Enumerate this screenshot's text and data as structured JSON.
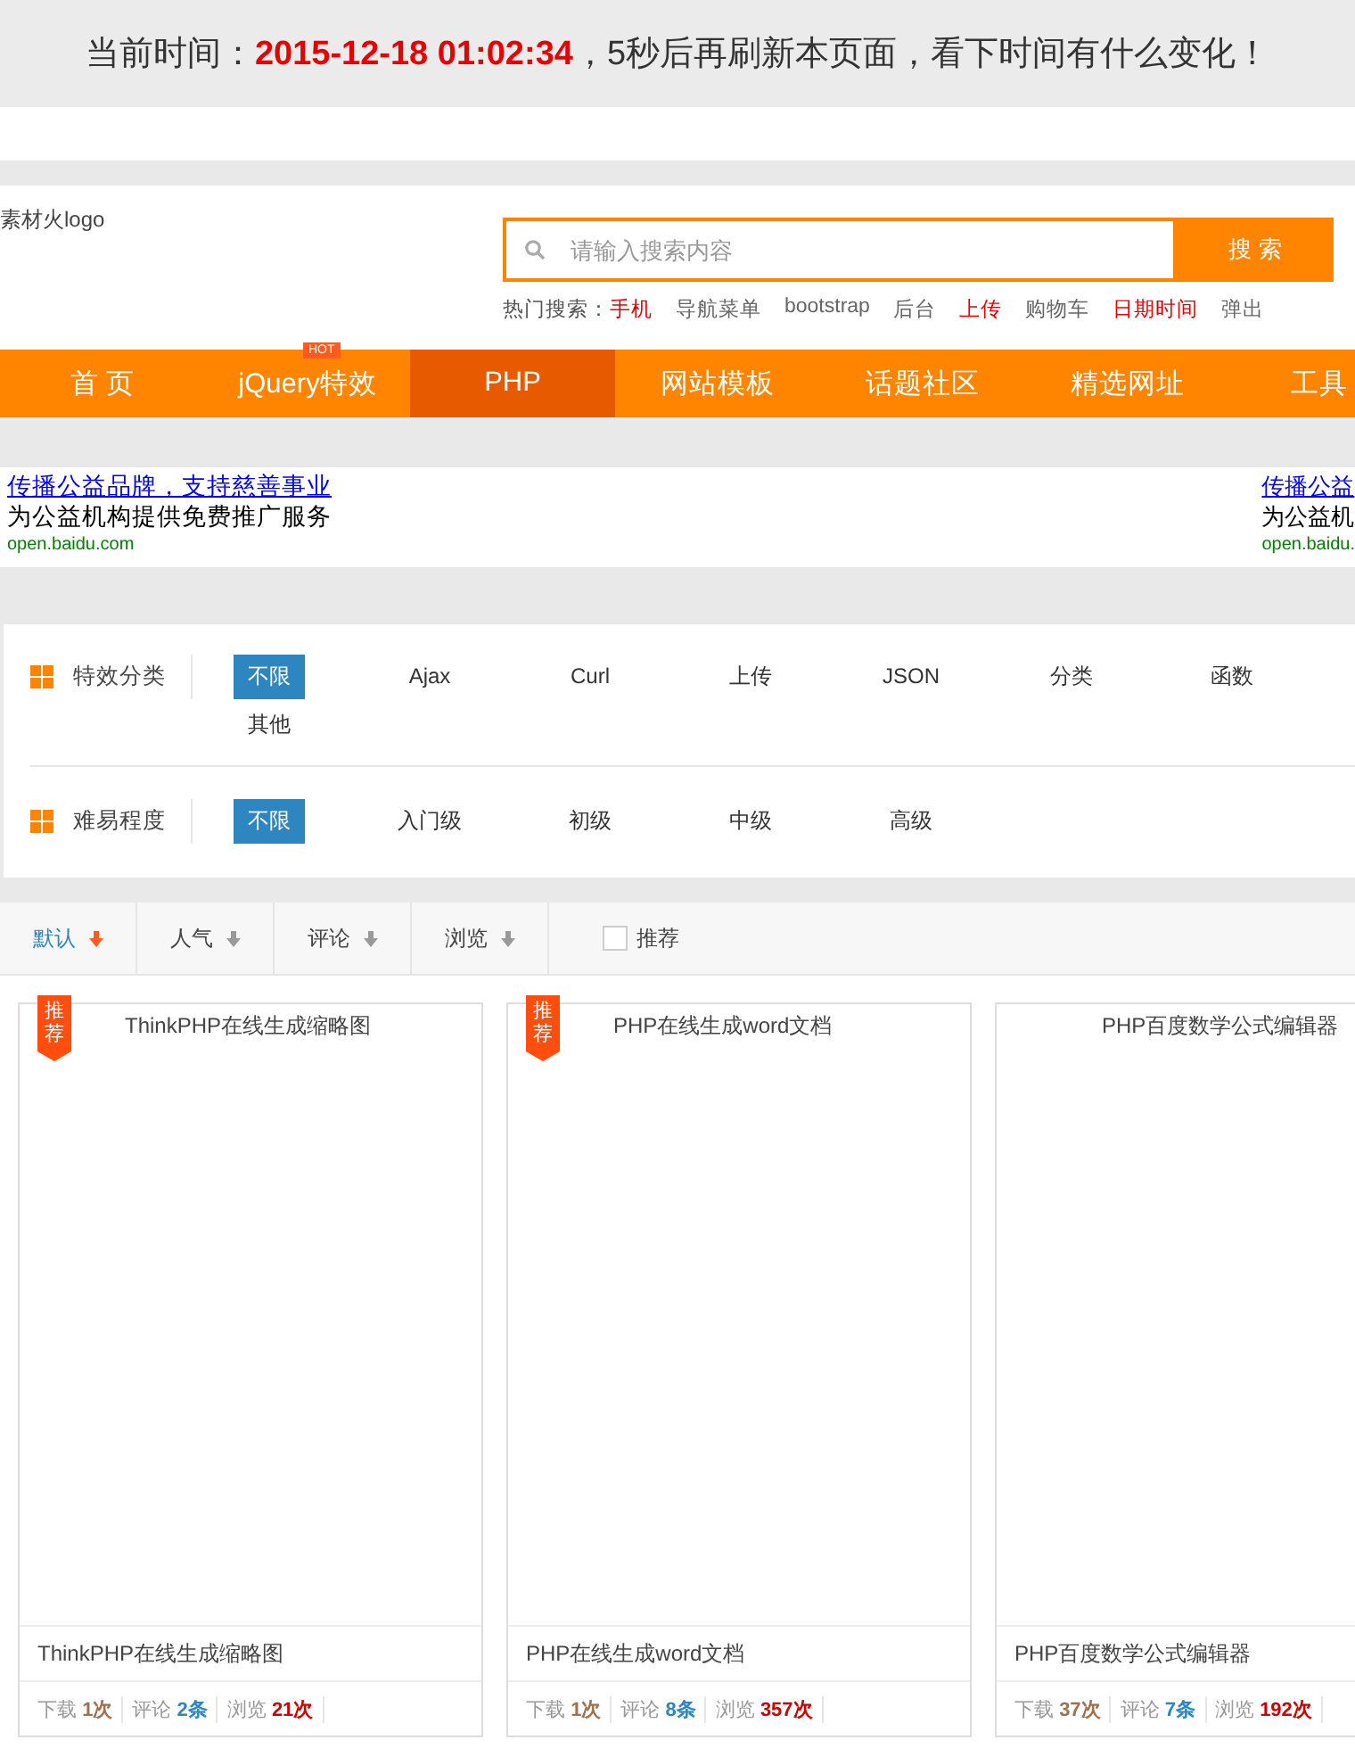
{
  "notice": {
    "prefix": "当前时间：",
    "time": "2015-12-18 01:02:34",
    "suffix": "，5秒后再刷新本页面，看下时间有什么变化！"
  },
  "header": {
    "logo": "素材火logo",
    "search": {
      "placeholder": "请输入搜索内容",
      "button": "搜 索"
    },
    "hot_label": "热门搜索：",
    "hot_items": [
      {
        "label": "手机",
        "hot": true
      },
      {
        "label": "导航菜单",
        "hot": false
      },
      {
        "label": "bootstrap",
        "hot": false
      },
      {
        "label": "后台",
        "hot": false
      },
      {
        "label": "上传",
        "hot": true
      },
      {
        "label": "购物车",
        "hot": false
      },
      {
        "label": "日期时间",
        "hot": true
      },
      {
        "label": "弹出",
        "hot": false
      }
    ]
  },
  "nav": [
    {
      "label": "首 页",
      "selected": false
    },
    {
      "label": "jQuery特效",
      "selected": false,
      "badge": "HOT"
    },
    {
      "label": "PHP",
      "selected": true
    },
    {
      "label": "网站模板",
      "selected": false
    },
    {
      "label": "话题社区",
      "selected": false
    },
    {
      "label": "精选网址",
      "selected": false
    },
    {
      "label": "工具",
      "selected": false
    }
  ],
  "ads": [
    {
      "link": "传播公益品牌，支持慈善事业",
      "text": "为公益机构提供免费推广服务",
      "url": "open.baidu.com"
    },
    {
      "link": "传播公益",
      "text": "为公益机",
      "url": "open.baidu."
    }
  ],
  "filters": [
    {
      "label": "特效分类",
      "options": [
        {
          "label": "不限",
          "selected": true
        },
        {
          "label": "Ajax",
          "selected": false
        },
        {
          "label": "Curl",
          "selected": false
        },
        {
          "label": "上传",
          "selected": false
        },
        {
          "label": "JSON",
          "selected": false
        },
        {
          "label": "分类",
          "selected": false
        },
        {
          "label": "函数",
          "selected": false
        },
        {
          "label": "其他",
          "selected": false
        }
      ]
    },
    {
      "label": "难易程度",
      "options": [
        {
          "label": "不限",
          "selected": true
        },
        {
          "label": "入门级",
          "selected": false
        },
        {
          "label": "初级",
          "selected": false
        },
        {
          "label": "中级",
          "selected": false
        },
        {
          "label": "高级",
          "selected": false
        }
      ]
    }
  ],
  "sort": {
    "tabs": [
      {
        "label": "默认",
        "selected": true
      },
      {
        "label": "人气",
        "selected": false
      },
      {
        "label": "评论",
        "selected": false
      },
      {
        "label": "浏览",
        "selected": false
      }
    ],
    "recommend": {
      "label": "推荐",
      "checked": false
    }
  },
  "cards": [
    {
      "badge": "推荐",
      "recommended": true,
      "thumb_title": "ThinkPHP在线生成缩略图",
      "title": "ThinkPHP在线生成缩略图",
      "stats": [
        {
          "kind": "download",
          "label": "下载",
          "value": "1次"
        },
        {
          "kind": "comment",
          "label": "评论",
          "value": "2条"
        },
        {
          "kind": "view",
          "label": "浏览",
          "value": "21次"
        }
      ]
    },
    {
      "badge": "推荐",
      "recommended": true,
      "thumb_title": "PHP在线生成word文档",
      "title": "PHP在线生成word文档",
      "stats": [
        {
          "kind": "download",
          "label": "下载",
          "value": "1次"
        },
        {
          "kind": "comment",
          "label": "评论",
          "value": "8条"
        },
        {
          "kind": "view",
          "label": "浏览",
          "value": "357次"
        }
      ]
    },
    {
      "recommended": false,
      "thumb_title": "PHP百度数学公式编辑器",
      "title": "PHP百度数学公式编辑器",
      "stats": [
        {
          "kind": "download",
          "label": "下载",
          "value": "37次"
        },
        {
          "kind": "comment",
          "label": "评论",
          "value": "7条"
        },
        {
          "kind": "view",
          "label": "浏览",
          "value": "192次"
        }
      ]
    }
  ]
}
